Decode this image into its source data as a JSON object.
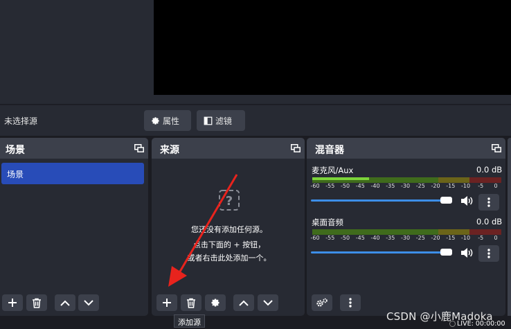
{
  "context_bar": {
    "source_label": "未选择源",
    "properties_label": "属性",
    "filters_label": "滤镜"
  },
  "scenes": {
    "title": "场景",
    "items": [
      "场景"
    ]
  },
  "sources": {
    "title": "来源",
    "empty_line1": "您还没有添加任何源。",
    "empty_line2": "点击下面的 + 按钮，",
    "empty_line3": "或者右击此处添加一个。",
    "tooltip": "添加源"
  },
  "mixer": {
    "title": "混音器",
    "channels": [
      {
        "name": "麦克风/Aux",
        "db": "0.0 dB",
        "level": 0.3,
        "volume": 1.0
      },
      {
        "name": "桌面音频",
        "db": "0.0 dB",
        "level": 0.0,
        "volume": 1.0
      }
    ],
    "tick_labels": [
      "-60",
      "-55",
      "-50",
      "-45",
      "-40",
      "-35",
      "-30",
      "-25",
      "-20",
      "-15",
      "-10",
      "-5",
      "0"
    ]
  },
  "watermark": "CSDN @小鹿Madoka",
  "status": {
    "live": "LIVE: 00:00:00"
  },
  "colors": {
    "accent": "#284cb8",
    "panel": "#272a33",
    "header": "#3c404b",
    "slider": "#3d8ee8"
  }
}
